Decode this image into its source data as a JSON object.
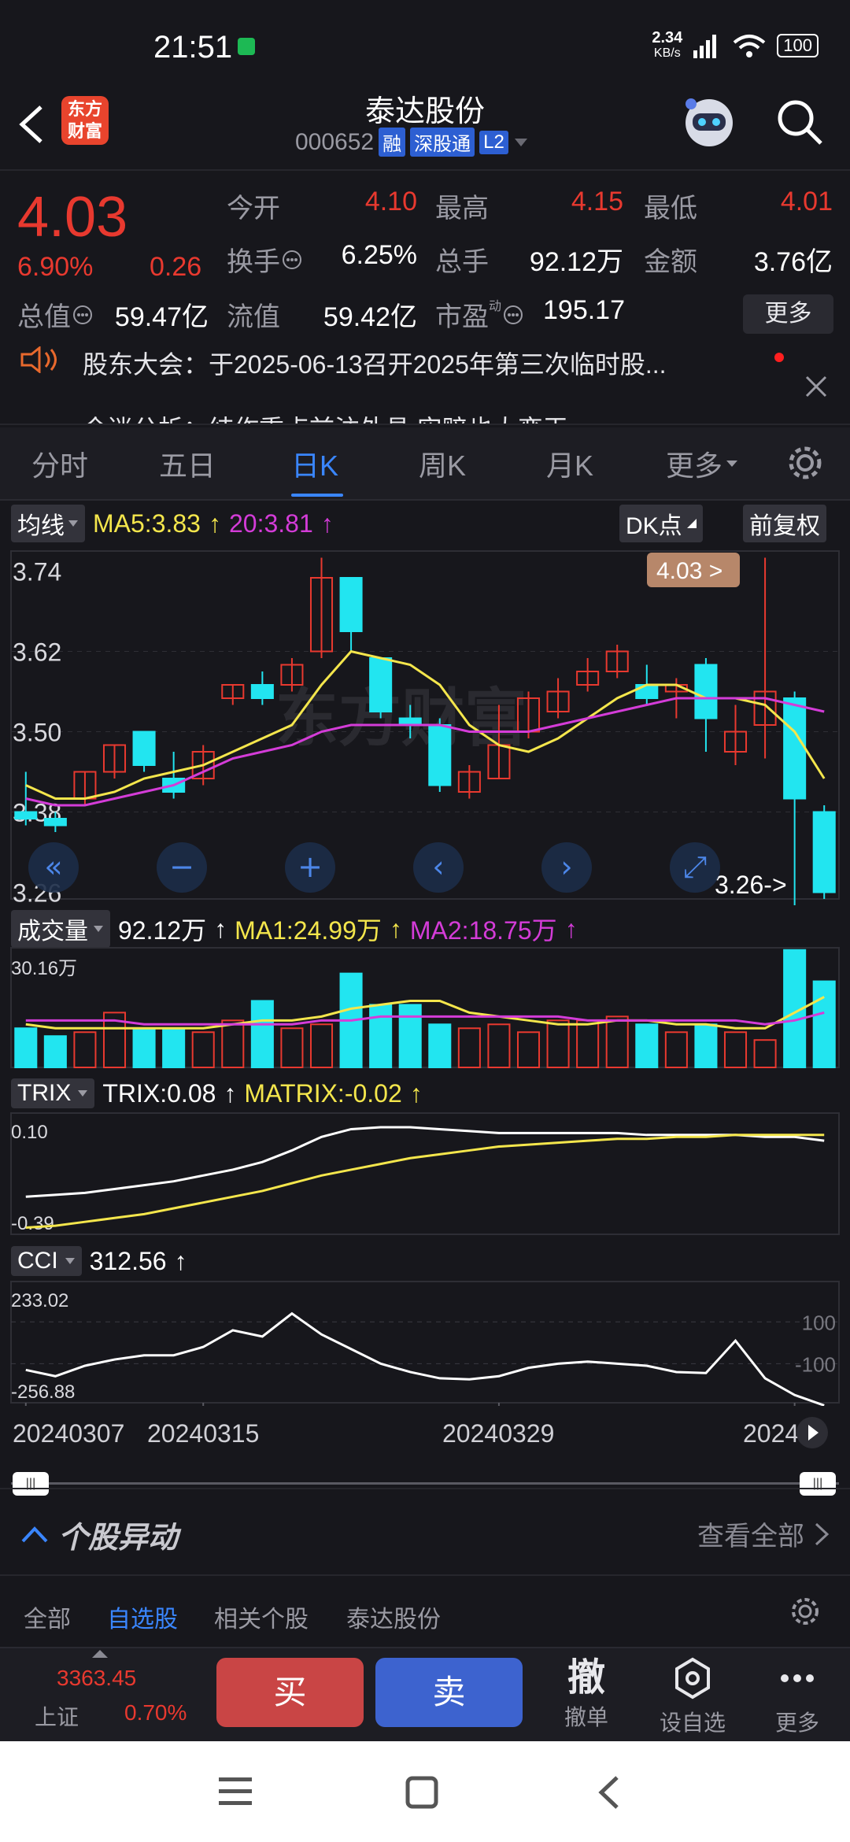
{
  "status": {
    "time": "21:51",
    "net_speed": "2.34",
    "net_unit": "KB/s",
    "battery": "100"
  },
  "header": {
    "logo_line1": "东方",
    "logo_line2": "财富",
    "stock_name": "泰达股份",
    "stock_code": "000652",
    "tags": [
      "融",
      "深股通",
      "L2"
    ]
  },
  "quote": {
    "price": "4.03",
    "change_pct": "6.90%",
    "change": "0.26",
    "open_label": "今开",
    "open": "4.10",
    "high_label": "最高",
    "high": "4.15",
    "low_label": "最低",
    "low": "4.01",
    "turnover_label": "换手",
    "turnover": "6.25%",
    "volume_label": "总手",
    "volume": "92.12万",
    "amount_label": "金额",
    "amount": "3.76亿",
    "mcap_label": "总值",
    "mcap": "59.47亿",
    "float_label": "流值",
    "float_mcap": "59.42亿",
    "pe_label": "市盈",
    "pe_superscript": "动",
    "pe": "195.17",
    "more_label": "更多"
  },
  "news": {
    "line1": "股东大会：于2025-06-13召开2025年第三次临时股...",
    "line2": "今迷公析：结作重点前注外具 实赔也大变王"
  },
  "tabs": [
    "分时",
    "五日",
    "日K",
    "周K",
    "月K",
    "更多"
  ],
  "active_tab": "日K",
  "kline": {
    "ma_selector": "均线",
    "ma5": "MA5:3.83",
    "ma20": "20:3.81",
    "dk_label": "DK点",
    "adjust_label": "前复权",
    "y_labels": [
      "3.74",
      "3.62",
      "3.50",
      "3.38",
      "3.26"
    ],
    "current_tag": "4.03",
    "low_tag": "3.26"
  },
  "volume": {
    "selector": "成交量",
    "value": "92.12万",
    "ma1": "MA1:24.99万",
    "ma2": "MA2:18.75万",
    "y_max": "30.16万"
  },
  "trix": {
    "selector": "TRIX",
    "trix": "TRIX:0.08",
    "matrix": "MATRIX:-0.02",
    "y_top": "0.10",
    "y_bottom": "-0.39"
  },
  "cci": {
    "selector": "CCI",
    "value": "312.56",
    "y_top": "233.02",
    "y_bottom": "-256.88",
    "ref_high": "100",
    "ref_low": "-100"
  },
  "dates": [
    "20240307",
    "20240315",
    "20240329",
    "2024"
  ],
  "activity": {
    "title": "个股异动",
    "view_all": "查看全部"
  },
  "filters": [
    "全部",
    "自选股",
    "相关个股",
    "泰达股份"
  ],
  "active_filter": "自选股",
  "trade": {
    "index_value": "3363.45",
    "index_name": "上证",
    "index_change": "0.70%",
    "buy": "买",
    "sell": "卖",
    "cancel_glyph": "撤",
    "cancel_label": "撤单",
    "watch_label": "设自选",
    "more_label": "更多"
  },
  "colors": {
    "up": "#e8392f",
    "down": "#22e5f0",
    "ma5": "#f4e64c",
    "ma20": "#d43cd8",
    "accent": "#3a86ff"
  }
}
